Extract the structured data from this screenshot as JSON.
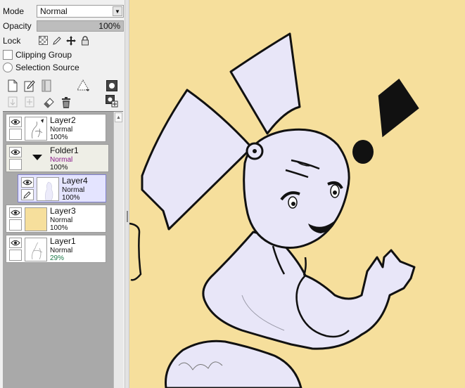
{
  "panel": {
    "mode_label": "Mode",
    "mode_value": "Normal",
    "opacity_label": "Opacity",
    "opacity_value": "100%",
    "lock_label": "Lock",
    "clipping_label": "Clipping Group",
    "selection_label": "Selection Source"
  },
  "layers": [
    {
      "name": "Layer2",
      "mode": "Normal",
      "opacity": "100%"
    },
    {
      "name": "Folder1",
      "mode": "Normal",
      "opacity": "100%"
    },
    {
      "name": "Layer4",
      "mode": "Normal",
      "opacity": "100%"
    },
    {
      "name": "Layer3",
      "mode": "Normal",
      "opacity": "100%"
    },
    {
      "name": "Layer1",
      "mode": "Normal",
      "opacity": "29%"
    }
  ],
  "colors": {
    "canvas_bg": "#f6df9c",
    "figure_fill": "#e8e6f8",
    "selected_layer": "#e4e4ff",
    "folder_mode": "#8a1a8a",
    "low_opacity": "#1e7a4a"
  },
  "icons": {
    "mode_arrow": "chevron-down-icon",
    "lock_transparency": "checker-lock-icon",
    "lock_brush": "pen-lock-icon",
    "lock_move": "move-lock-icon",
    "lock_all": "padlock-icon",
    "new_layer": "new-page-icon",
    "new_linework": "pen-page-icon",
    "new_folder": "folder-page-icon",
    "layer_settings": "triangle-tool-icon",
    "mask": "mask-icon",
    "transfer_down": "transfer-down-icon",
    "merge_down": "merge-down-icon",
    "clear": "eraser-icon",
    "delete": "trash-icon",
    "add_mask": "add-mask-icon",
    "visibility": "eye-icon",
    "folder_toggle": "triangle-down-icon"
  }
}
